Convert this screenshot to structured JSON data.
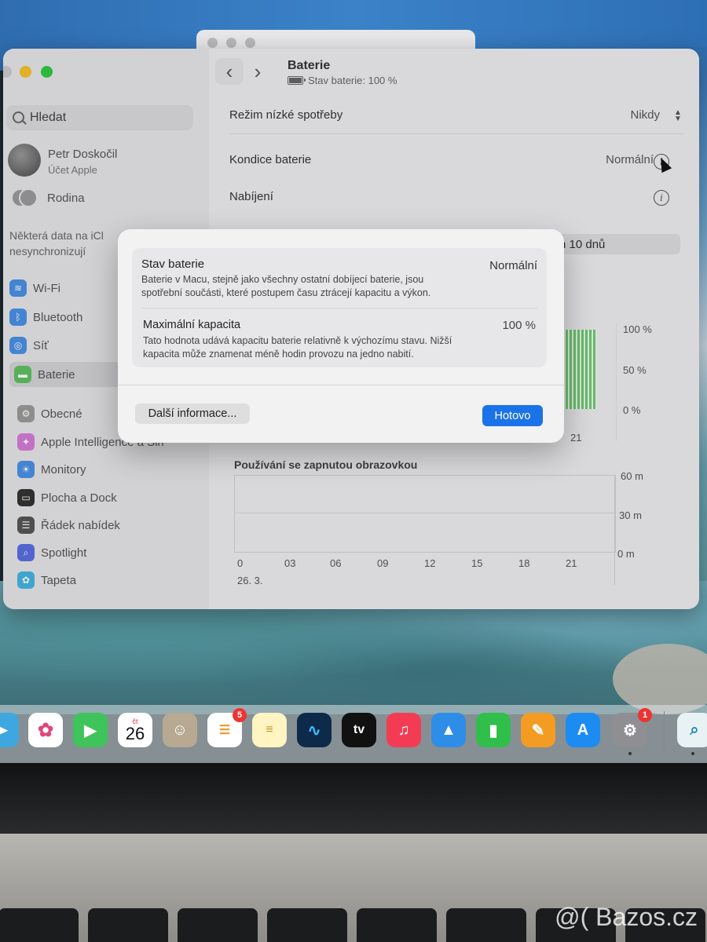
{
  "sidebar": {
    "search_placeholder": "Hledat",
    "account_name": "Petr Doskočil",
    "account_sub": "Účet Apple",
    "family": "Rodina",
    "sync_warning_1": "Některá data na iCl",
    "sync_warning_2": "nesynchronizují",
    "items": [
      {
        "label": "Wi-Fi"
      },
      {
        "label": "Bluetooth"
      },
      {
        "label": "Síť"
      },
      {
        "label": "Baterie"
      },
      {
        "label": "Obecné"
      },
      {
        "label": "Apple Intelligence a Siri"
      },
      {
        "label": "Monitory"
      },
      {
        "label": "Plocha a Dock"
      },
      {
        "label": "Řádek nabídek"
      },
      {
        "label": "Spotlight"
      },
      {
        "label": "Tapeta"
      }
    ]
  },
  "header": {
    "title": "Baterie",
    "subtitle": "Stav baterie: 100 %"
  },
  "settings": {
    "low_power_label": "Režim nízké spotřeby",
    "low_power_value": "Nikdy",
    "health_label": "Kondice baterie",
    "health_value": "Normální",
    "charging_label": "Nabíjení",
    "range_fragment": "n 10 dnů"
  },
  "battery_chart": {
    "y_labels": [
      "100 %",
      "50 %",
      "0 %"
    ],
    "x_label_visible": "21"
  },
  "screen_chart": {
    "title": "Používání se zapnutou obrazovkou",
    "y_labels": [
      "60 m",
      "30 m",
      "0 m"
    ],
    "x_labels": [
      "0",
      "03",
      "06",
      "09",
      "12",
      "15",
      "18",
      "21"
    ],
    "date": "26. 3."
  },
  "dialog": {
    "health_title": "Stav baterie",
    "health_value": "Normální",
    "health_desc_1": "Baterie v Macu, stejně jako všechny ostatní dobíjecí baterie, jsou",
    "health_desc_2": "spotřební součásti, které postupem času ztrácejí kapacitu a výkon.",
    "capacity_title": "Maximální kapacita",
    "capacity_value": "100 %",
    "capacity_desc_1": "Tato hodnota udává kapacitu baterie relativně k výchozímu stavu. Nižší",
    "capacity_desc_2": "kapacita může znamenat méně hodin provozu na jedno nabití.",
    "more_button": "Další informace...",
    "done_button": "Hotovo"
  },
  "dock": {
    "calendar_day_label": "čt",
    "calendar_day": "26",
    "reminders_badge": "5",
    "settings_badge": "1",
    "tv_label": "tv"
  },
  "watermark": "@( Bazos.cz"
}
